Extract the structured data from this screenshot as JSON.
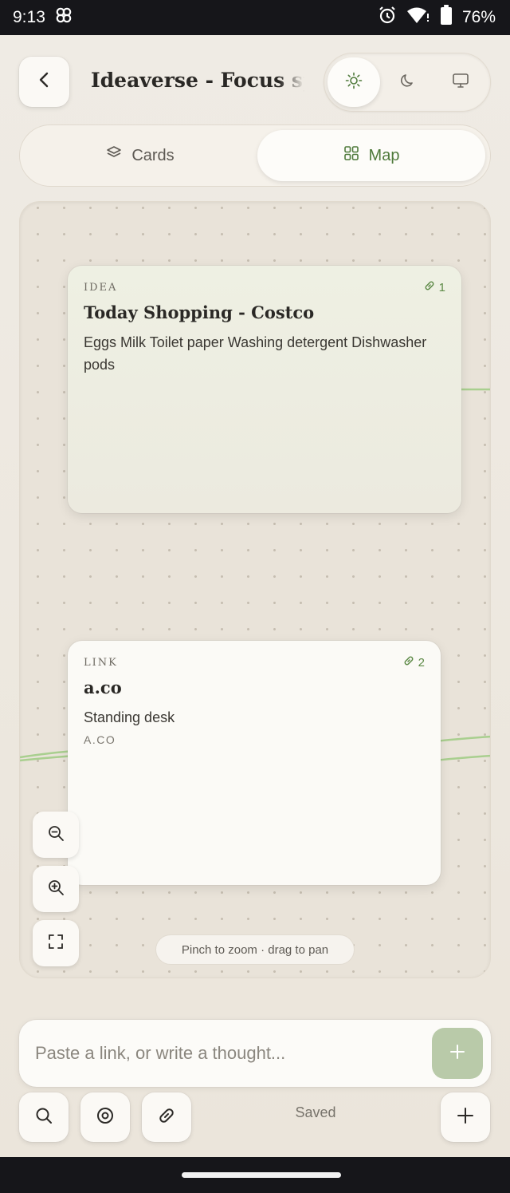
{
  "status_bar": {
    "time": "9:13",
    "battery": "76%",
    "icons": [
      "pinwheel-icon",
      "alarm-icon",
      "wifi-icon",
      "battery-icon"
    ]
  },
  "header": {
    "title": "Ideaverse - Focus spr",
    "back_icon": "chevron-left-icon",
    "theme_options": [
      "sun-icon",
      "moon-icon",
      "monitor-icon"
    ],
    "theme_selected": "light"
  },
  "view_toggle": {
    "cards_label": "Cards",
    "map_label": "Map",
    "selected": "Map"
  },
  "map": {
    "cards": [
      {
        "type": "IDEA",
        "link_count": "1",
        "title": "Today Shopping - Costco",
        "body": "Eggs Milk Toilet paper Washing detergent Dishwasher pods"
      },
      {
        "type": "LINK",
        "link_count": "2",
        "title": "a.co",
        "body": "Standing desk",
        "domain": "A.CO"
      }
    ],
    "hint": "Pinch to zoom · drag to pan",
    "edge_color": "#a9cf8f"
  },
  "composer": {
    "placeholder": "Paste a link, or write a thought..."
  },
  "toolbar": {
    "saved_label": "Saved"
  },
  "colors": {
    "accent": "#5d8a47",
    "background": "#ece6dc",
    "card": "#fbfaf6"
  }
}
